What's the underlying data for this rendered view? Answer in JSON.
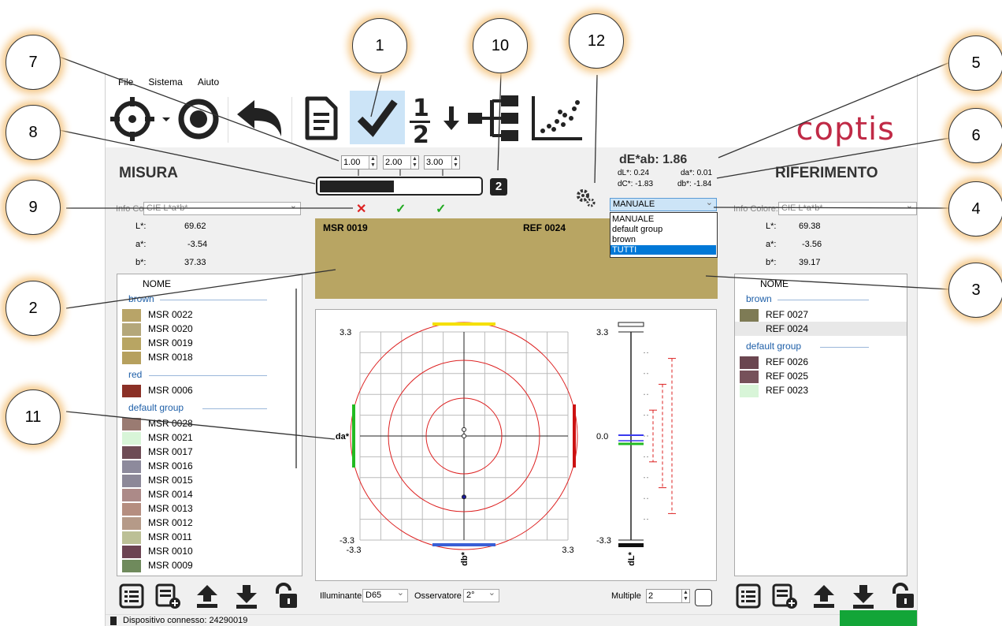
{
  "menu": [
    "File",
    "Sistema",
    "Aiuto"
  ],
  "toolbar": {
    "buttons": [
      "target-icon",
      "record-icon",
      "undo-icon",
      "document-icon",
      "check-icon",
      "one-half-icon",
      "down-arrow-icon",
      "tree-icon",
      "scatter-icon"
    ],
    "logo": "coptis"
  },
  "tolerance": {
    "values": [
      "1.00",
      "2.00",
      "3.00"
    ],
    "badge": "2",
    "marks": [
      "✕",
      "✓",
      "✓"
    ]
  },
  "measure": {
    "title": "MISURA",
    "info_label": "Info Colore:",
    "info_value": "CIE L*a*b*",
    "L_label": "L*:",
    "L": "69.62",
    "a_label": "a*:",
    "a": "-3.54",
    "b_label": "b*:",
    "b": "37.33",
    "col_header": "NOME",
    "groups": [
      {
        "name": "brown",
        "items": [
          {
            "name": "MSR 0022",
            "color": "#b8a468"
          },
          {
            "name": "MSR 0020",
            "color": "#b4a77a"
          },
          {
            "name": "MSR 0019",
            "color": "#b8a563"
          },
          {
            "name": "MSR 0018",
            "color": "#b6a05e"
          }
        ]
      },
      {
        "name": "red",
        "items": [
          {
            "name": "MSR 0006",
            "color": "#8b3026"
          }
        ]
      },
      {
        "name": "default group",
        "items": [
          {
            "name": "MSR 0028",
            "color": "#9a7b72"
          },
          {
            "name": "MSR 0021",
            "color": "#d8f5d8"
          },
          {
            "name": "MSR 0017",
            "color": "#6e4c55"
          },
          {
            "name": "MSR 0016",
            "color": "#8d8a9c"
          },
          {
            "name": "MSR 0015",
            "color": "#8c8898"
          },
          {
            "name": "MSR 0014",
            "color": "#ac8a88"
          },
          {
            "name": "MSR 0013",
            "color": "#b58e80"
          },
          {
            "name": "MSR 0012",
            "color": "#b59a88"
          },
          {
            "name": "MSR 0011",
            "color": "#bcc096"
          },
          {
            "name": "MSR 0010",
            "color": "#6c4352"
          },
          {
            "name": "MSR 0009",
            "color": "#6f8a5c"
          }
        ]
      }
    ]
  },
  "reference": {
    "title": "RIFERIMENTO",
    "info_label": "Info Colore:",
    "info_value": "CIE L*a*b*",
    "L_label": "L*:",
    "L": "69.38",
    "a_label": "a*:",
    "a": "-3.56",
    "b_label": "b*:",
    "b": "39.17",
    "col_header": "NOME",
    "groups": [
      {
        "name": "brown",
        "items": [
          {
            "name": "REF 0027",
            "color": "#7e7b55"
          },
          {
            "name": "REF 0024",
            "color": ""
          }
        ]
      },
      {
        "name": "default group",
        "items": [
          {
            "name": "REF 0026",
            "color": "#6b4650"
          },
          {
            "name": "REF 0025",
            "color": "#76515a"
          },
          {
            "name": "REF 0023",
            "color": "#d8f5d8"
          }
        ]
      }
    ]
  },
  "delta": {
    "dE": "dE*ab: 1.86",
    "dL": "dL*: 0.24",
    "da": "da*: 0.01",
    "dC": "dC*: -1.83",
    "db": "db*: -1.84"
  },
  "group_select": {
    "value": "MANUALE",
    "options": [
      "MANUALE",
      "default group",
      "brown",
      "TUTTI"
    ],
    "highlighted": "TUTTI"
  },
  "preview": {
    "left_label": "MSR 0019",
    "right_label": "REF 0024",
    "color": "#b8a563"
  },
  "plot": {
    "ab_max": "3.3",
    "ab_min": "-3.3",
    "x_min": "-3.3",
    "x_max": "3.3",
    "da_label": "da*",
    "db_label": "db*",
    "L_max": "3.3",
    "L_zero": "0.0",
    "L_min": "-3.3",
    "L_label": "dL*"
  },
  "chart_data": {
    "type": "scatter",
    "xlabel": "db*",
    "ylabel": "da*",
    "xlim": [
      -3.3,
      3.3
    ],
    "ylim": [
      -3.3,
      3.3
    ],
    "tolerance_circles": [
      1.0,
      2.0,
      3.0
    ],
    "points": [
      {
        "x": 0.0,
        "y": -1.84,
        "filled": true
      },
      {
        "x": 0.0,
        "y": 0.24,
        "filled": false
      },
      {
        "x": 0.0,
        "y": 0.0,
        "filled": false
      }
    ],
    "dL": {
      "ylim": [
        -3.3,
        3.3
      ],
      "value": 0.24,
      "tolerances": [
        1.0,
        2.0,
        3.0
      ]
    }
  },
  "bottom": {
    "illum_label": "Illuminante",
    "illum": "D65",
    "obs_label": "Osservatore",
    "obs": "2°",
    "multiple_label": "Multiple",
    "multiple": "2"
  },
  "status": "Dispositivo connesso: 24290019",
  "callouts": [
    "1",
    "2",
    "3",
    "4",
    "5",
    "6",
    "7",
    "8",
    "9",
    "10",
    "11",
    "12"
  ]
}
